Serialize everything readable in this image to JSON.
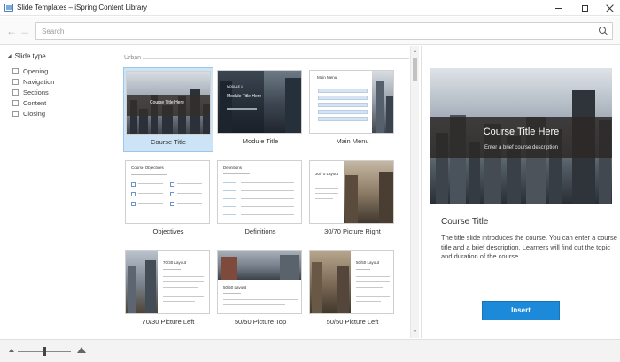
{
  "window": {
    "title": "Slide Templates – iSpring Content Library"
  },
  "search": {
    "placeholder": "Search",
    "value": ""
  },
  "filters": {
    "heading": "Slide type",
    "items": [
      {
        "label": "Opening",
        "checked": false
      },
      {
        "label": "Navigation",
        "checked": false
      },
      {
        "label": "Sections",
        "checked": false
      },
      {
        "label": "Content",
        "checked": false
      },
      {
        "label": "Closing",
        "checked": false
      }
    ]
  },
  "gallery": {
    "section": "Urban",
    "templates": [
      {
        "label": "Course Title",
        "selected": true,
        "thumb_title": "Course Title Here"
      },
      {
        "label": "Module Title",
        "selected": false,
        "thumb_title": "Module Title Here",
        "thumb_kicker": "MODULE 1"
      },
      {
        "label": "Main Menu",
        "selected": false,
        "thumb_title": "Main Menu"
      },
      {
        "label": "Objectives",
        "selected": false,
        "thumb_title": "Course Objectives"
      },
      {
        "label": "Definitions",
        "selected": false,
        "thumb_title": "Definitions"
      },
      {
        "label": "30/70 Picture Right",
        "selected": false,
        "thumb_title": "30/70 Layout"
      },
      {
        "label": "70/30 Picture Left",
        "selected": false,
        "thumb_title": "70/30 Layout"
      },
      {
        "label": "50/50 Picture Top",
        "selected": false,
        "thumb_title": "50/50 Layout"
      },
      {
        "label": "50/50 Picture Left",
        "selected": false,
        "thumb_title": "50/50 Layout"
      }
    ]
  },
  "preview": {
    "slide_title": "Course Title Here",
    "slide_subtitle": "Enter a brief course description",
    "title": "Course Title",
    "description": "The title slide introduces the course. You can enter a course title and a brief description. Learners will find out the topic and duration of the course.",
    "insert_label": "Insert"
  },
  "icons": {
    "back": "arrow-left-icon",
    "forward": "arrow-right-icon",
    "search": "search-icon",
    "zoom_out": "zoom-small-icon",
    "zoom_in": "zoom-large-icon"
  },
  "colors": {
    "accent": "#1c8ad9",
    "selection": "#cde3f6"
  },
  "zoom": {
    "level": 0.5
  }
}
